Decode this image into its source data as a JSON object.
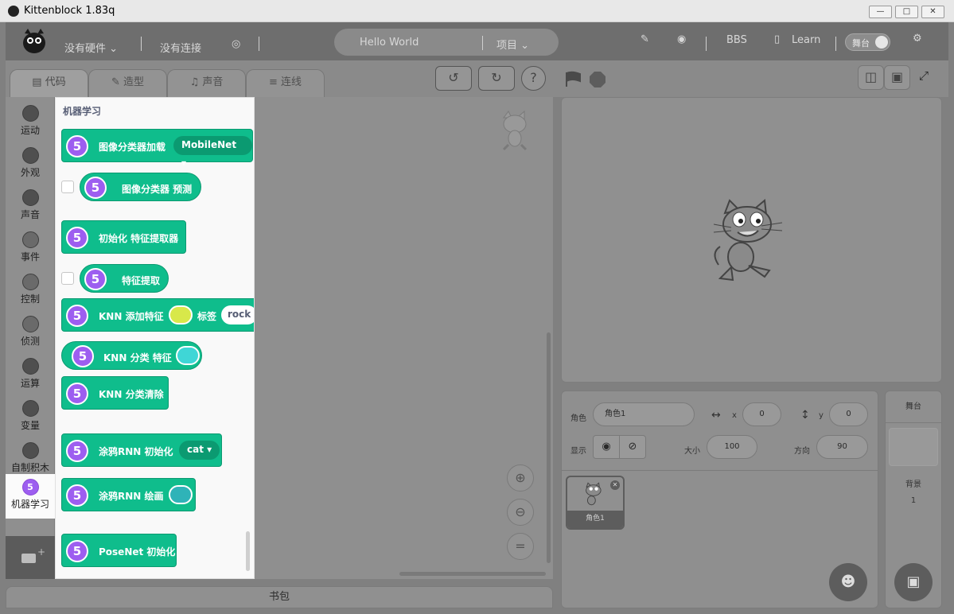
{
  "window": {
    "title": "Kittenblock 1.83q"
  },
  "menubar": {
    "hardware": "没有硬件",
    "connect": "没有连接",
    "project_title": "Hello World",
    "project_menu": "项目",
    "bbs": "BBS",
    "learn": "Learn",
    "stage_toggle_label": "舞台"
  },
  "tabs": {
    "code": "代码",
    "costumes": "造型",
    "sounds": "声音",
    "connect": "连线"
  },
  "categories": [
    "运动",
    "外观",
    "声音",
    "事件",
    "控制",
    "侦测",
    "运算",
    "变量",
    "自制积木",
    "机器学习"
  ],
  "extension_badge": "5",
  "palette": {
    "title": "机器学习",
    "blocks": {
      "b1": "图像分类器加载",
      "b1_dropdown": "MobileNet",
      "b2": "图像分类器 预测",
      "b3": "初始化 特征提取器",
      "b4": "特征提取",
      "b5": "KNN 添加特征",
      "b5_label": "标签",
      "b5_value": "rock",
      "b6": "KNN 分类 特征",
      "b7": "KNN 分类清除",
      "b8": "涂鸦RNN 初始化",
      "b8_dropdown": "cat",
      "b9": "涂鸦RNN 绘画",
      "b10": "PoseNet 初始化"
    },
    "colors": {
      "block": "#0fbd8c",
      "badge": "#9d5ef0",
      "b5_color": "#d8e84a",
      "b6_color": "#3fd6d6",
      "b9_color": "#2fb3b8"
    }
  },
  "backpack": "书包",
  "sprite_info": {
    "sprite_label": "角色",
    "sprite_name": "角色1",
    "x_label": "x",
    "x": "0",
    "y_label": "y",
    "y": "0",
    "show_label": "显示",
    "size_label": "大小",
    "size": "100",
    "direction_label": "方向",
    "direction": "90"
  },
  "sprite_list": [
    {
      "name": "角色1"
    }
  ],
  "stage_pane": {
    "title": "舞台",
    "backdrops_label": "背景",
    "backdrops_count": "1"
  }
}
